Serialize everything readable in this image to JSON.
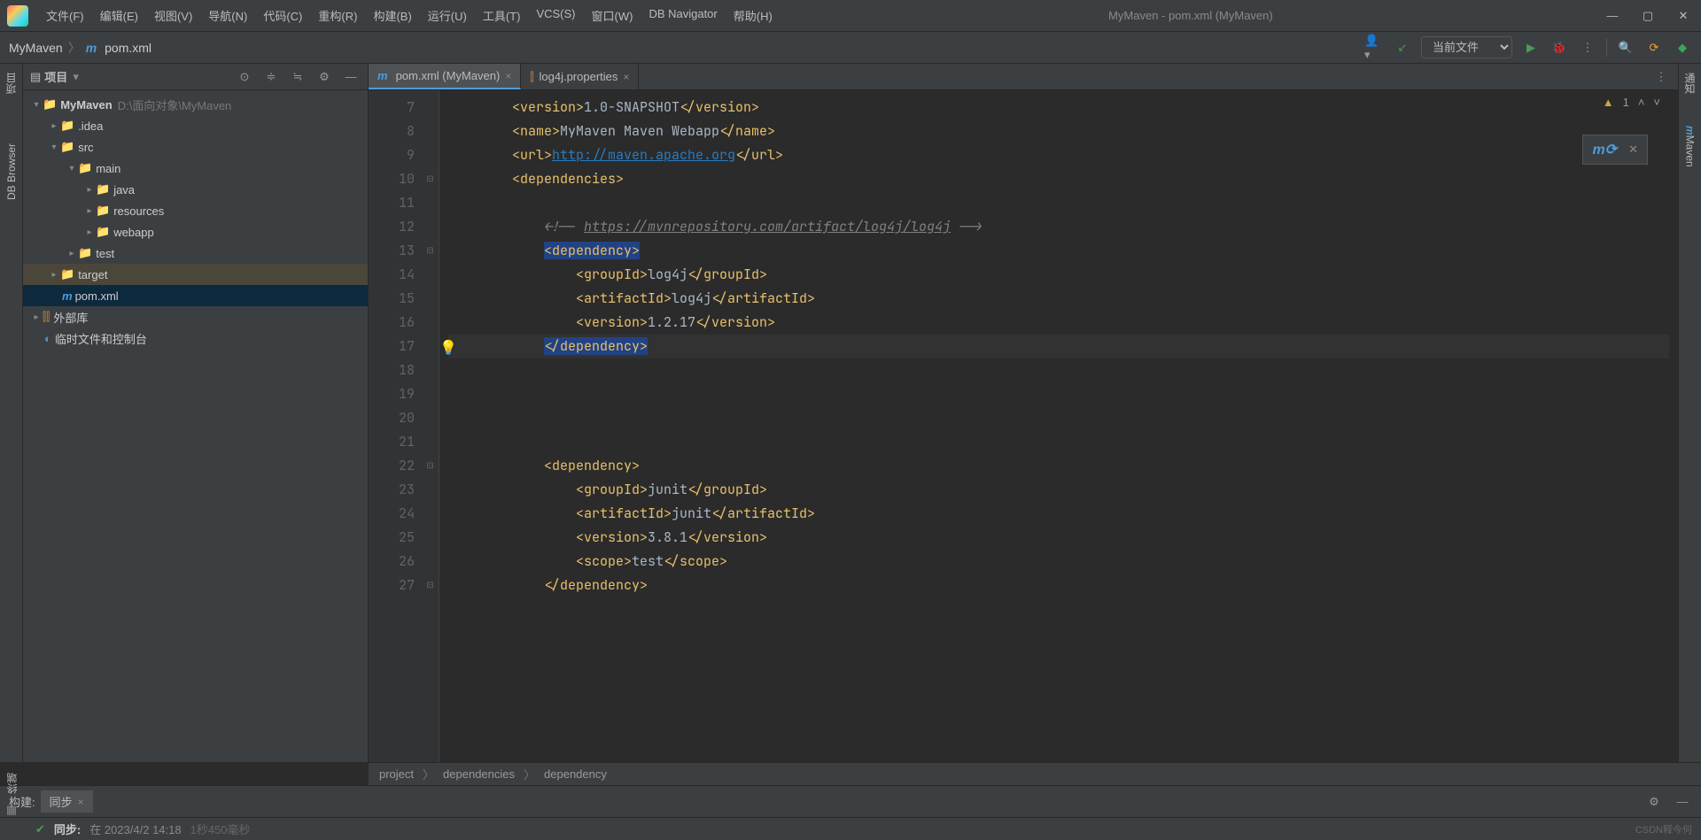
{
  "title": "MyMaven - pom.xml (MyMaven)",
  "menu": [
    "文件(F)",
    "编辑(E)",
    "视图(V)",
    "导航(N)",
    "代码(C)",
    "重构(R)",
    "构建(B)",
    "运行(U)",
    "工具(T)",
    "VCS(S)",
    "窗口(W)",
    "DB Navigator",
    "帮助(H)"
  ],
  "breadcrumb": {
    "root": "MyMaven",
    "file": "pom.xml"
  },
  "runConfig": "当前文件",
  "leftTabs": {
    "project": "项目",
    "dbBrowser": "DB Browser"
  },
  "rightTabs": {
    "notifications": "通知",
    "maven": "Maven"
  },
  "projectPanel": {
    "title": "项目"
  },
  "tree": {
    "root": {
      "name": "MyMaven",
      "path": "D:\\面向对象\\MyMaven"
    },
    "idea": ".idea",
    "src": "src",
    "main": "main",
    "java": "java",
    "resources": "resources",
    "webapp": "webapp",
    "test": "test",
    "target": "target",
    "pom": "pom.xml",
    "external": "外部库",
    "scratches": "临时文件和控制台"
  },
  "tabs": [
    {
      "label": "pom.xml (MyMaven)",
      "active": true
    },
    {
      "label": "log4j.properties",
      "active": false
    }
  ],
  "warnings": "1",
  "editor": {
    "startLine": 7,
    "lines": [
      {
        "n": 7,
        "indent": 8,
        "html": "<span class='tag'>&lt;version&gt;</span><span class='text'>1.0-SNAPSHOT</span><span class='tag'>&lt;/version&gt;</span>"
      },
      {
        "n": 8,
        "indent": 8,
        "html": "<span class='tag'>&lt;name&gt;</span><span class='text'>MyMaven Maven Webapp</span><span class='tag'>&lt;/name&gt;</span>"
      },
      {
        "n": 9,
        "indent": 8,
        "html": "<span class='tag'>&lt;url&gt;</span><span class='link'>http://maven.apache.org</span><span class='tag'>&lt;/url&gt;</span>"
      },
      {
        "n": 10,
        "indent": 8,
        "fold": "−",
        "html": "<span class='tag'>&lt;dependencies&gt;</span>"
      },
      {
        "n": 11,
        "indent": 8,
        "html": ""
      },
      {
        "n": 12,
        "indent": 12,
        "html": "<span class='comment'>&lt;!-- </span><span class='comment link'>https://mvnrepository.com/artifact/log4j/log4j</span><span class='comment'> --&gt;</span>"
      },
      {
        "n": 13,
        "indent": 12,
        "fold": "−",
        "html": "<span class='tag hl-tag'>&lt;dependency&gt;</span>"
      },
      {
        "n": 14,
        "indent": 16,
        "html": "<span class='tag'>&lt;groupId&gt;</span><span class='text'>log4j</span><span class='tag'>&lt;/groupId&gt;</span>"
      },
      {
        "n": 15,
        "indent": 16,
        "html": "<span class='tag'>&lt;artifactId&gt;</span><span class='text'>log4j</span><span class='tag'>&lt;/artifactId&gt;</span>"
      },
      {
        "n": 16,
        "indent": 16,
        "html": "<span class='tag'>&lt;version&gt;</span><span class='text'>1.2.17</span><span class='tag'>&lt;/version&gt;</span>"
      },
      {
        "n": 17,
        "indent": 12,
        "current": true,
        "html": "<span class='tag hl-tag'>&lt;/dependency&gt;</span>"
      },
      {
        "n": 18,
        "indent": 8,
        "html": ""
      },
      {
        "n": 19,
        "indent": 8,
        "html": ""
      },
      {
        "n": 20,
        "indent": 8,
        "html": ""
      },
      {
        "n": 21,
        "indent": 8,
        "html": ""
      },
      {
        "n": 22,
        "indent": 12,
        "fold": "−",
        "html": "<span class='tag'>&lt;dependency&gt;</span>"
      },
      {
        "n": 23,
        "indent": 16,
        "html": "<span class='tag'>&lt;groupId&gt;</span><span class='text'>junit</span><span class='tag'>&lt;/groupId&gt;</span>"
      },
      {
        "n": 24,
        "indent": 16,
        "html": "<span class='tag'>&lt;artifactId&gt;</span><span class='text'>junit</span><span class='tag'>&lt;/artifactId&gt;</span>"
      },
      {
        "n": 25,
        "indent": 16,
        "html": "<span class='tag'>&lt;version&gt;</span><span class='text'>3.8.1</span><span class='tag'>&lt;/version&gt;</span>"
      },
      {
        "n": 26,
        "indent": 16,
        "html": "<span class='tag'>&lt;scope&gt;</span><span class='text'>test</span><span class='tag'>&lt;/scope&gt;</span>"
      },
      {
        "n": 27,
        "indent": 12,
        "fold": "−",
        "html": "<span class='tag'>&lt;/dependency&gt;</span>"
      }
    ]
  },
  "breadcrumbBar": [
    "project",
    "dependencies",
    "dependency"
  ],
  "build": {
    "label": "构建:",
    "tab": "同步",
    "status": "同步:",
    "detail": "在 2023/4/2 14:18",
    "duration": "1秒450毫秒"
  },
  "leftBottom": "终端",
  "watermark": "CSDN释今何"
}
